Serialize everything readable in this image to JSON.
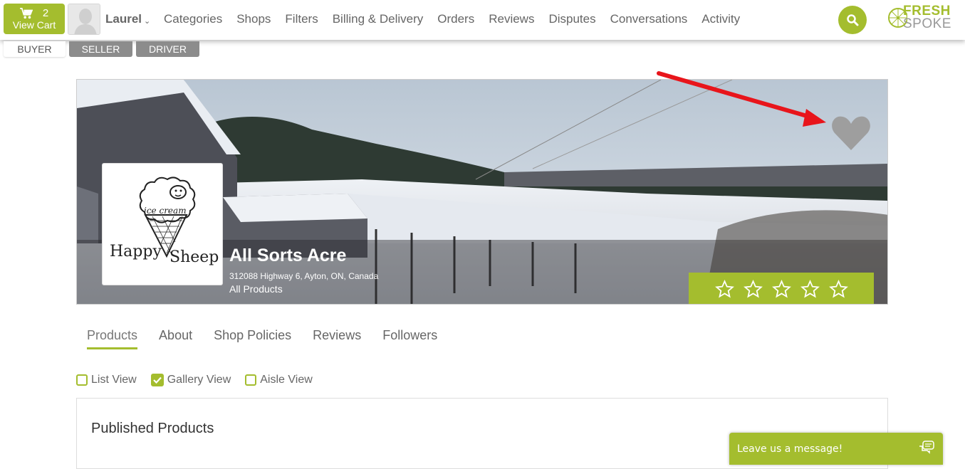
{
  "cart": {
    "count": "2",
    "label": "View Cart",
    "icon": "shopping-cart-icon"
  },
  "user": {
    "name": "Laurel",
    "avatar_icon": "user-silhouette-icon"
  },
  "nav": {
    "items": [
      "Categories",
      "Shops",
      "Filters",
      "Billing & Delivery",
      "Orders",
      "Reviews",
      "Disputes",
      "Conversations",
      "Activity"
    ]
  },
  "search": {
    "icon": "search-icon"
  },
  "logo": {
    "line1": "FRESH",
    "line2": "SPOKE"
  },
  "roles": {
    "tabs": [
      "BUYER",
      "SELLER",
      "DRIVER"
    ],
    "active": "BUYER"
  },
  "shop": {
    "name": "All Sorts Acre",
    "address": "312088 Highway 6, Ayton, ON, Canada",
    "products_link": "All Products",
    "logo_text_top": "ice cream",
    "logo_text_bottom": "Happy Sheep",
    "rating_stars": 5,
    "rating_value": 0,
    "favorite_icon": "heart-icon"
  },
  "shop_tabs": {
    "items": [
      "Products",
      "About",
      "Shop Policies",
      "Reviews",
      "Followers"
    ],
    "active": "Products"
  },
  "view_options": [
    {
      "label": "List View",
      "checked": false
    },
    {
      "label": "Gallery View",
      "checked": true
    },
    {
      "label": "Aisle View",
      "checked": false
    }
  ],
  "products_panel": {
    "title": "Published Products"
  },
  "chat": {
    "label": "Leave us a message!",
    "icon": "chat-bubbles-icon"
  },
  "colors": {
    "brand_green": "#a4bd2e",
    "inactive_tab_gray": "#8c8c8c",
    "annotation_arrow": "#e8151b"
  }
}
